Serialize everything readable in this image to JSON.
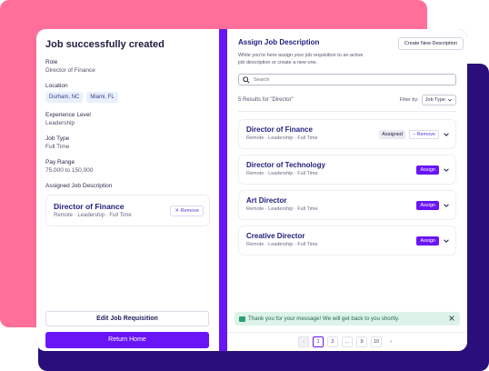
{
  "left": {
    "title": "Job successfully created",
    "role": {
      "label": "Role",
      "value": "Director of Finance"
    },
    "location": {
      "label": "Location",
      "chips": [
        "Durham, NC",
        "Miami, FL"
      ]
    },
    "experience": {
      "label": "Experience Level",
      "value": "Leadership"
    },
    "job_type": {
      "label": "Job Type",
      "value": "Full Time"
    },
    "pay": {
      "label": "Pay Range",
      "value": "75,000 to 150,000"
    },
    "assigned": {
      "label": "Assigned Job Description",
      "title": "Director of Finance",
      "meta": "Remote · Leadership · Full Time",
      "remove_label": "Remove",
      "remove_icon": "x-icon"
    },
    "edit_label": "Edit Job Requisition",
    "home_label": "Return Home"
  },
  "right": {
    "title": "Assign Job Description",
    "new_label": "Create New Description",
    "description": "While you're here assign your job requisition to an active job description or create a new one.",
    "search": {
      "placeholder": "Search",
      "icon": "search-icon"
    },
    "results": "5 Results for \"Director\"",
    "filter": {
      "label": "Filter by:",
      "value": "Job Type"
    },
    "cards": [
      {
        "title": "Director of Finance",
        "meta": "Remote · Leadership · Full Time",
        "assigned_label": "Assigned",
        "remove_label": "Remove"
      },
      {
        "title": "Director of Technology",
        "meta": "Remote · Leadership · Full Time",
        "assign_label": "Assign"
      },
      {
        "title": "Art Director",
        "meta": "Remote · Leadership · Full Time",
        "assign_label": "Assign"
      },
      {
        "title": "Creative Director",
        "meta": "Remote · Leadership · Full Time",
        "assign_label": "Assign"
      }
    ],
    "toast": {
      "text": "Thank you for your message! We will get back to you shortly.",
      "icon": "message-icon"
    },
    "pager": {
      "pages": [
        "1",
        "2",
        "...",
        "9",
        "10"
      ],
      "active": "1"
    }
  },
  "colors": {
    "accent": "#6a15f5",
    "pink": "#ff6f9a",
    "navy": "#2a0f7a",
    "toast_bg": "#ddf3ea"
  }
}
